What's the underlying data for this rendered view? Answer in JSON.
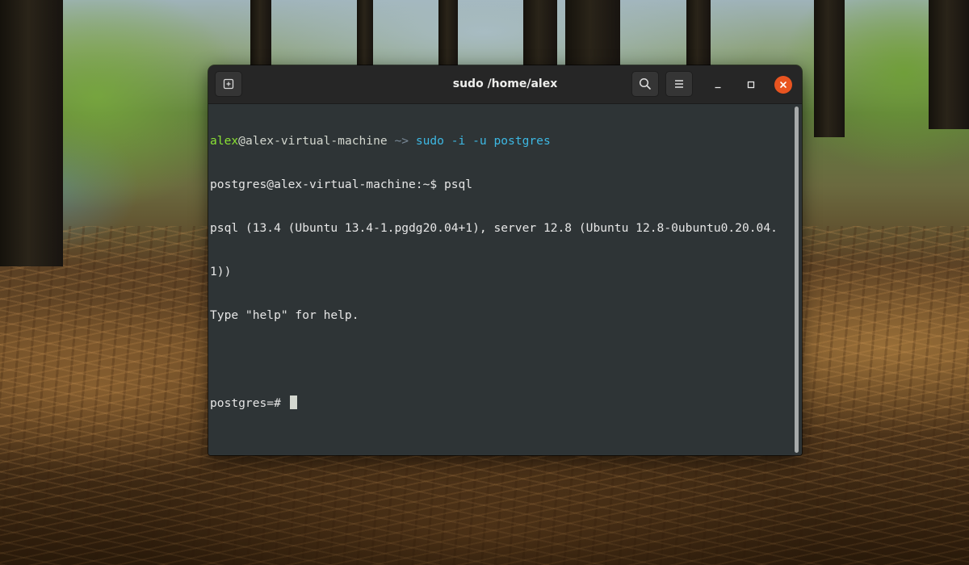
{
  "window": {
    "title": "sudo /home/alex"
  },
  "header": {
    "new_tab_icon": "new-tab-icon",
    "search_icon": "search-icon",
    "menu_icon": "hamburger-menu-icon",
    "minimize_icon": "minimize-icon",
    "maximize_icon": "maximize-icon",
    "close_icon": "close-icon"
  },
  "terminal": {
    "prompt1": {
      "user": "alex",
      "host": "@alex-virtual-machine",
      "path": " ~>",
      "command": " sudo -i -u postgres"
    },
    "line2": "postgres@alex-virtual-machine:~$ psql",
    "line3": "psql (13.4 (Ubuntu 13.4-1.pgdg20.04+1), server 12.8 (Ubuntu 12.8-0ubuntu0.20.04.",
    "line4": "1))",
    "line5": "Type \"help\" for help.",
    "line6": "",
    "prompt_final": "postgres=# "
  },
  "colors": {
    "terminal_bg": "#2e3436",
    "header_bg": "#262626",
    "user_green": "#8ae234",
    "command_blue": "#3db8e3",
    "close_orange": "#e95420"
  }
}
